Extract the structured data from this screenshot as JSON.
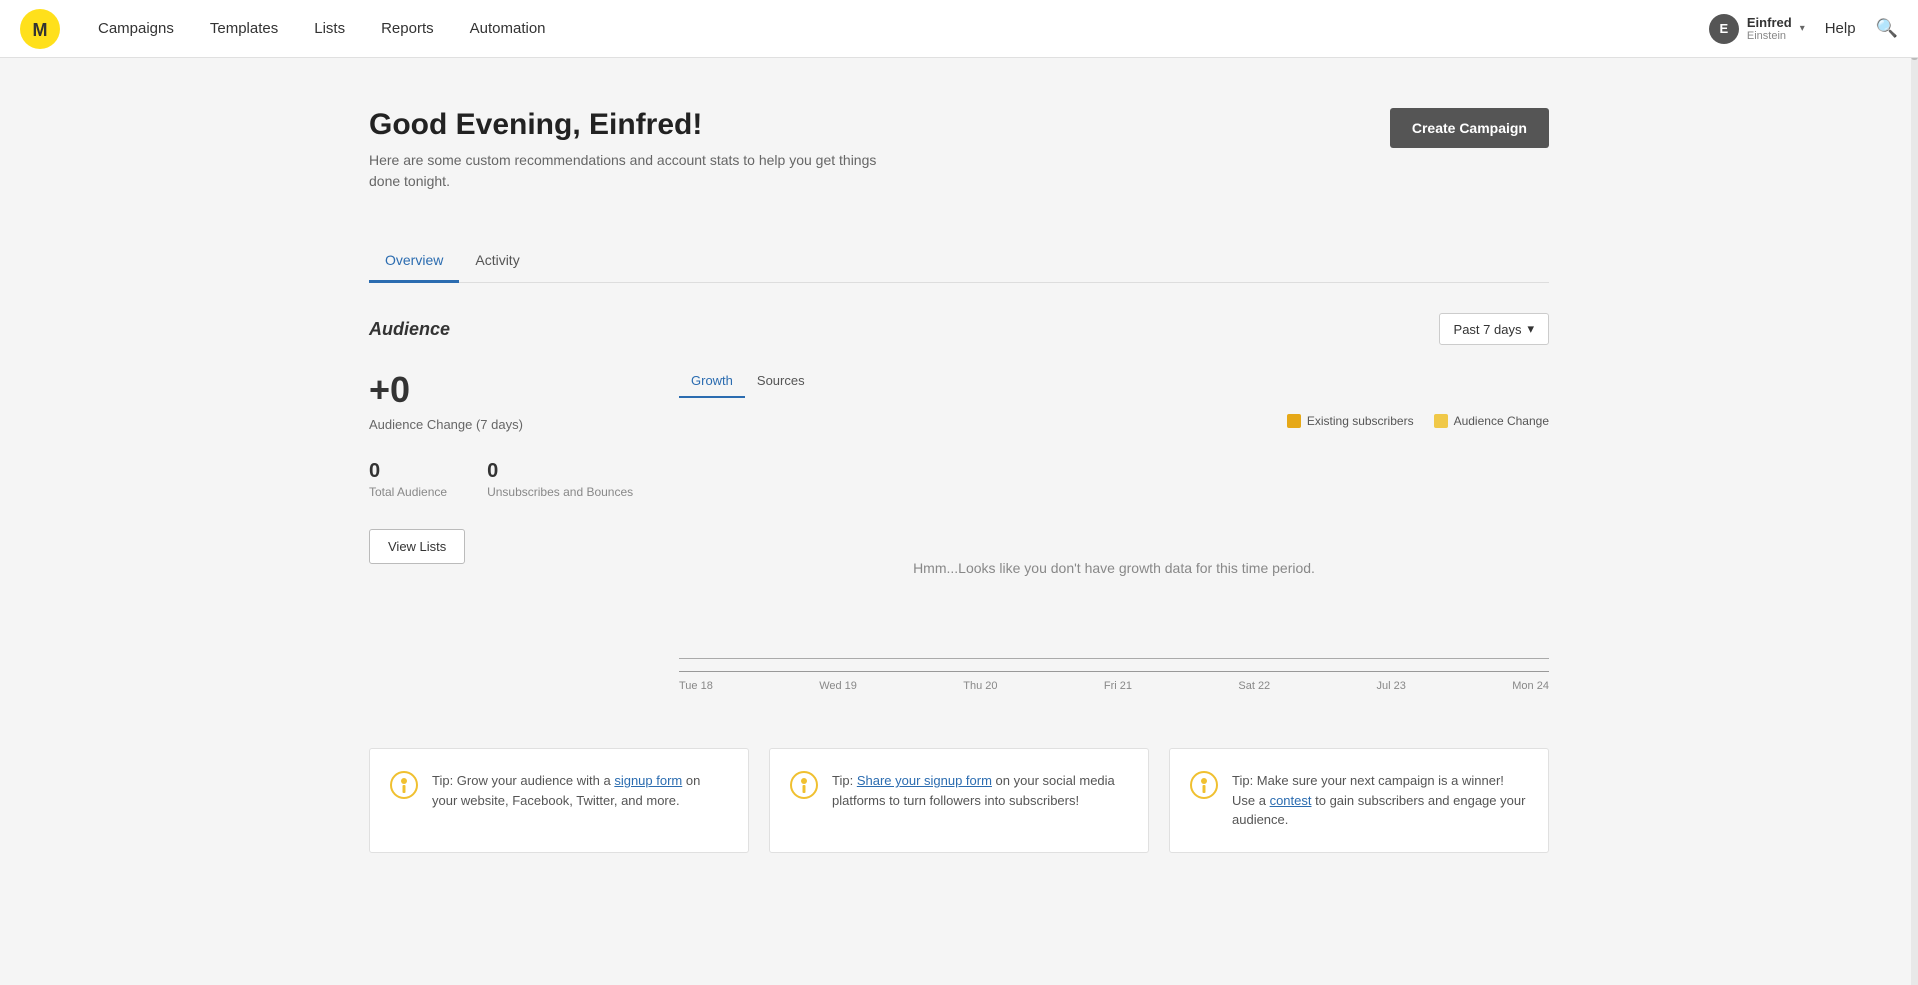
{
  "nav": {
    "logo_alt": "Mailchimp",
    "items": [
      {
        "label": "Campaigns",
        "id": "campaigns"
      },
      {
        "label": "Templates",
        "id": "templates"
      },
      {
        "label": "Lists",
        "id": "lists"
      },
      {
        "label": "Reports",
        "id": "reports"
      },
      {
        "label": "Automation",
        "id": "automation"
      }
    ],
    "user": {
      "initials": "E",
      "name": "Einfred",
      "sub": "Einstein",
      "chevron": "▾"
    },
    "help": "Help"
  },
  "header": {
    "greeting": "Good Evening, Einfred!",
    "subtitle": "Here are some custom recommendations and account stats to help you get things done tonight.",
    "create_btn": "Create Campaign"
  },
  "tabs": [
    {
      "label": "Overview",
      "active": true
    },
    {
      "label": "Activity",
      "active": false
    }
  ],
  "audience_section": {
    "title": "Audience",
    "period_btn": "Past 7 days",
    "period_chevron": "▾",
    "change_value": "+0",
    "change_label": "Audience Change (7 days)",
    "total_audience_value": "0",
    "total_audience_label": "Total Audience",
    "unsubscribes_value": "0",
    "unsubscribes_label": "Unsubscribes and Bounces",
    "view_lists_btn": "View Lists",
    "chart_tabs": [
      {
        "label": "Growth",
        "active": true
      },
      {
        "label": "Sources",
        "active": false
      }
    ],
    "legend": [
      {
        "label": "Existing subscribers",
        "color": "#e6a817"
      },
      {
        "label": "Audience Change",
        "color": "#f0c848"
      }
    ],
    "no_data_msg": "Hmm...Looks like you don't have growth data for this time period.",
    "x_axis_labels": [
      "Tue 18",
      "Wed 19",
      "Thu 20",
      "Fri 21",
      "Sat 22",
      "Jul 23",
      "Mon 24"
    ]
  },
  "tips": [
    {
      "text_before": "Tip: Grow your audience with a ",
      "link_text": "signup form",
      "text_after": " on your website, Facebook, Twitter, and more."
    },
    {
      "text_before": "Tip: ",
      "link_text": "Share your signup form",
      "text_after": " on your social media platforms to turn followers into subscribers!"
    },
    {
      "text_before": "Tip: Make sure your next campaign is a winner! Use a ",
      "link_text": "contest",
      "text_after": " to gain subscribers and engage your audience."
    }
  ]
}
